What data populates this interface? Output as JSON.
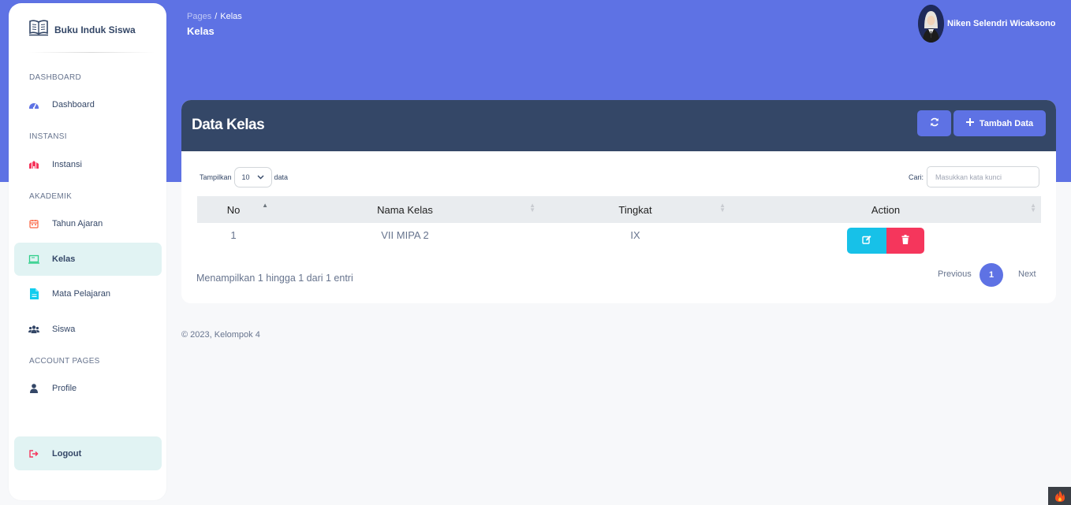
{
  "brand": {
    "name": "Buku Induk Siswa",
    "icon": "book-icon"
  },
  "sidebar": {
    "sections": [
      {
        "title": "DASHBOARD"
      },
      {
        "title": "INSTANSI"
      },
      {
        "title": "AKADEMIK"
      },
      {
        "title": "ACCOUNT PAGES"
      }
    ],
    "items": [
      {
        "label": "Dashboard",
        "icon": "dashboard-icon",
        "color": "#5e72e4"
      },
      {
        "label": "Instansi",
        "icon": "institution-icon",
        "color": "#f5365c"
      },
      {
        "label": "Tahun Ajaran",
        "icon": "calendar-icon",
        "color": "#fb6340"
      },
      {
        "label": "Kelas",
        "icon": "classroom-icon",
        "color": "#2dce89",
        "active": true
      },
      {
        "label": "Mata Pelajaran",
        "icon": "document-icon",
        "color": "#11cdef"
      },
      {
        "label": "Siswa",
        "icon": "users-icon",
        "color": "#344767"
      },
      {
        "label": "Profile",
        "icon": "user-icon",
        "color": "#344767"
      },
      {
        "label": "Logout",
        "icon": "logout-icon",
        "color": "#f5365c"
      }
    ]
  },
  "header": {
    "breadcrumb": {
      "root": "Pages",
      "separator": "/",
      "current": "Kelas"
    },
    "title": "Kelas",
    "user_name": "Niken Selendri Wicaksono"
  },
  "card": {
    "title": "Data Kelas",
    "add_label": "Tambah Data",
    "refresh_icon": "refresh-icon"
  },
  "table_controls": {
    "length_prefix": "Tampilkan",
    "length_value": "10",
    "length_suffix": "data",
    "search_label": "Cari:",
    "search_placeholder": "Masukkan kata kunci"
  },
  "table": {
    "columns": [
      "No",
      "Nama Kelas",
      "Tingkat",
      "Action"
    ],
    "rows": [
      {
        "no": "1",
        "nama_kelas": "VII MIPA 2",
        "tingkat": "IX"
      }
    ]
  },
  "pagination": {
    "info": "Menampilkan 1 hingga 1 dari 1 entri",
    "previous": "Previous",
    "page": "1",
    "next": "Next"
  },
  "footer": {
    "text": "© 2023, Kelompok 4"
  },
  "colors": {
    "primary": "#5e72e4",
    "dark": "#344767",
    "info": "#17c1e8",
    "danger": "#f5365c"
  }
}
